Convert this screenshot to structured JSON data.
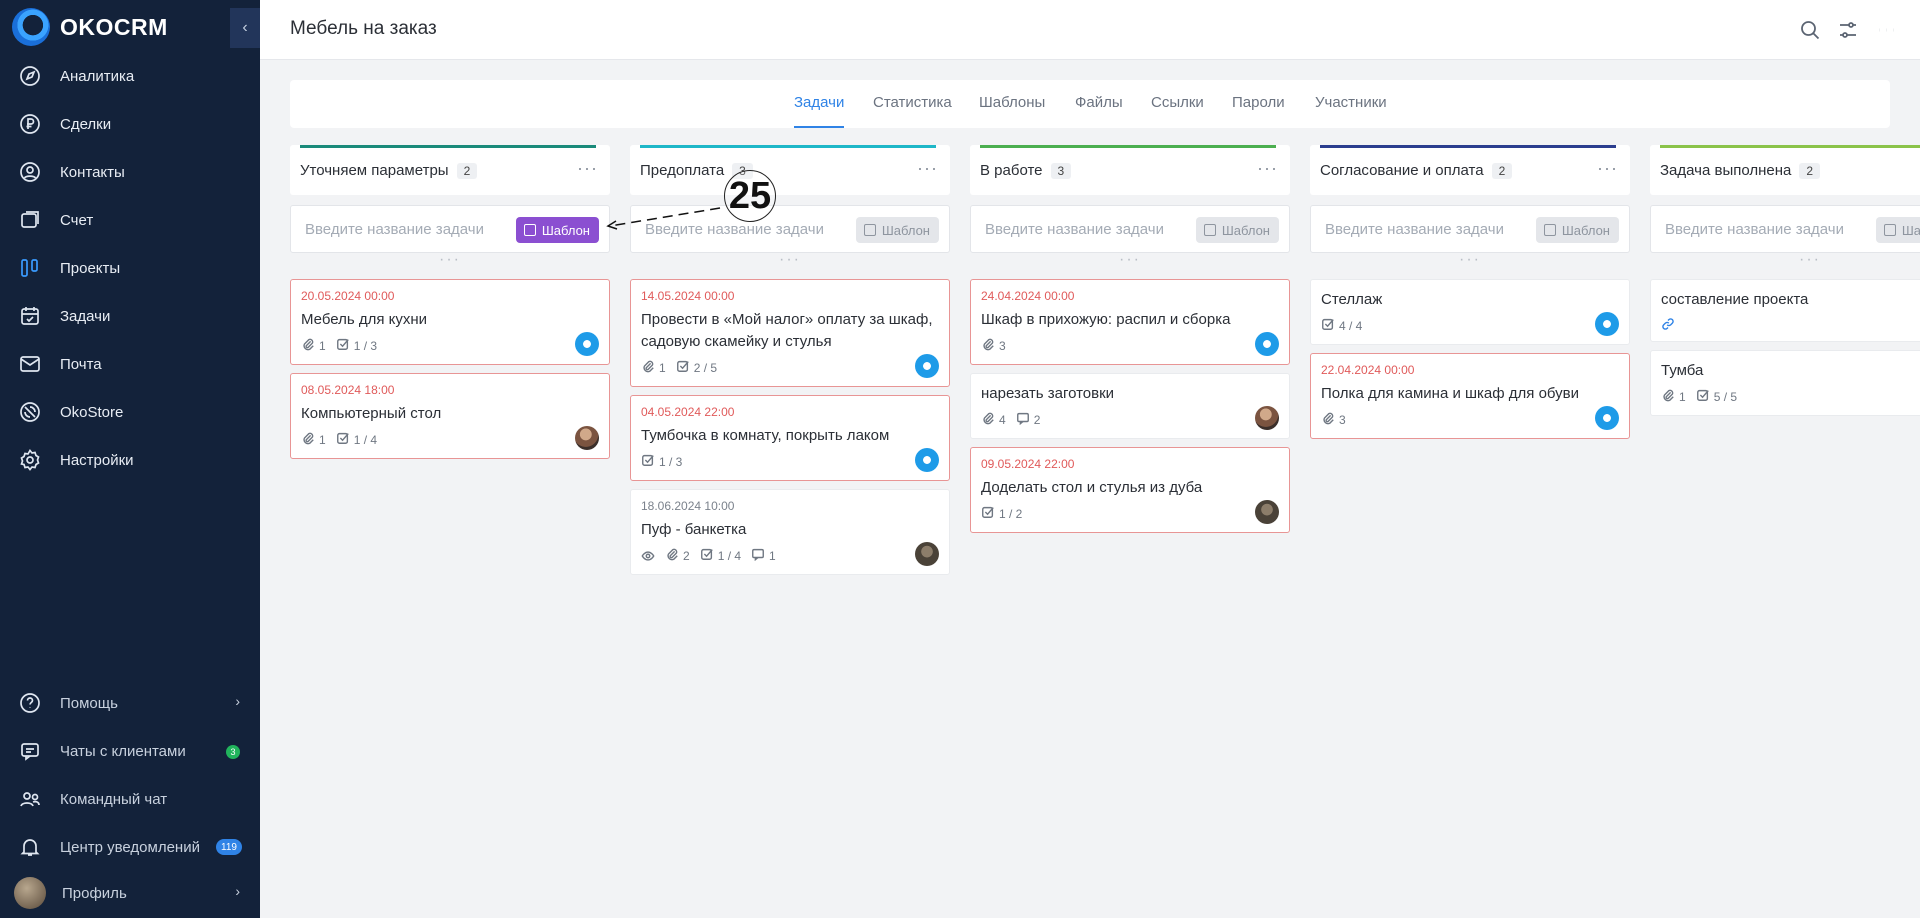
{
  "app": {
    "logo": "OKOCRM",
    "collapse_icon": "chevron-left-icon"
  },
  "sidebar": {
    "items": [
      {
        "label": "Аналитика",
        "icon": "compass-icon"
      },
      {
        "label": "Сделки",
        "icon": "ruble-icon"
      },
      {
        "label": "Контакты",
        "icon": "user-circle-icon"
      },
      {
        "label": "Счет",
        "icon": "invoice-icon"
      },
      {
        "label": "Проекты",
        "icon": "columns-icon",
        "active": true
      },
      {
        "label": "Задачи",
        "icon": "calendar-check-icon"
      },
      {
        "label": "Почта",
        "icon": "mail-icon"
      },
      {
        "label": "OkoStore",
        "icon": "store-icon"
      },
      {
        "label": "Настройки",
        "icon": "gear-icon"
      }
    ],
    "bottom": [
      {
        "label": "Помощь",
        "icon": "help-icon"
      },
      {
        "label": "Чаты с клиентами",
        "icon": "chat-icon",
        "badge": "3"
      },
      {
        "label": "Командный чат",
        "icon": "team-icon"
      },
      {
        "label": "Центр уведомлений",
        "icon": "bell-icon",
        "badge": "119"
      },
      {
        "label": "Профиль",
        "icon": "avatar"
      }
    ]
  },
  "header": {
    "title": "Мебель на заказ"
  },
  "tabs": [
    "Задачи",
    "Статистика",
    "Шаблоны",
    "Файлы",
    "Ссылки",
    "Пароли",
    "Участники"
  ],
  "new_task_placeholder": "Введите название задачи",
  "template_label": "Шаблон",
  "annotation": "25",
  "columns": [
    {
      "name": "Уточняем параметры",
      "count": "2",
      "color": "#1a8a7a",
      "cards": [
        {
          "date": "20.05.2024 00:00",
          "title": "Мебель для кухни",
          "attach": "1",
          "checks": "1 / 3",
          "overdue": true
        },
        {
          "date": "08.05.2024 18:00",
          "title": "Компьютерный стол",
          "attach": "1",
          "checks": "1 / 4",
          "overdue": true
        }
      ]
    },
    {
      "name": "Предоплата",
      "count": "3",
      "color": "#1fb7c8",
      "cards": [
        {
          "date": "14.05.2024 00:00",
          "title": "Провести в «Мой налог» оплату за шкаф, садовую скамейку и стулья",
          "attach": "1",
          "checks": "2 / 5",
          "overdue": true
        },
        {
          "date": "04.05.2024 22:00",
          "title": "Тумбочка в комнату, покрыть лаком",
          "checks": "1 / 3",
          "overdue": true
        },
        {
          "date": "18.06.2024 10:00",
          "title": "Пуф - банкетка",
          "attach": "2",
          "checks": "1 / 4",
          "comments": "1",
          "overdue": false
        }
      ]
    },
    {
      "name": "В работе",
      "count": "3",
      "color": "#4caf50",
      "cards": [
        {
          "date": "24.04.2024 00:00",
          "title": "Шкаф в прихожую: распил и сборка",
          "attach": "3",
          "overdue": true
        },
        {
          "title": "нарезать заготовки",
          "attach": "4",
          "comments": "2",
          "overdue": false
        },
        {
          "date": "09.05.2024 22:00",
          "title": "Доделать стол и стулья из дуба",
          "checks": "1 / 2",
          "overdue": true
        }
      ]
    },
    {
      "name": "Согласование и оплата",
      "count": "2",
      "color": "#2c3e8f",
      "cards": [
        {
          "title": "Стеллаж",
          "checks": "4 / 4",
          "overdue": false
        },
        {
          "date": "22.04.2024 00:00",
          "title": "Полка для камина и шкаф для обуви",
          "attach": "3",
          "overdue": true
        }
      ]
    },
    {
      "name": "Задача выполнена",
      "count": "2",
      "color": "#8bc34a",
      "cards": [
        {
          "title": "составление проекта",
          "overdue": false
        },
        {
          "title": "Тумба",
          "attach": "1",
          "checks": "5 / 5",
          "overdue": false
        }
      ]
    }
  ]
}
